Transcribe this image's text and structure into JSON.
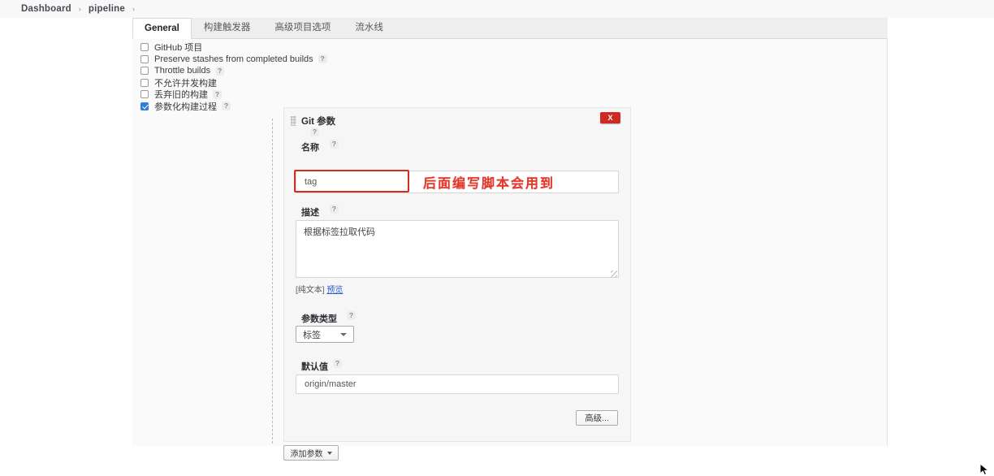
{
  "breadcrumb": {
    "items": [
      "Dashboard",
      "pipeline"
    ],
    "separator": "›"
  },
  "tabs": [
    {
      "label": "General",
      "active": true
    },
    {
      "label": "构建触发器",
      "active": false
    },
    {
      "label": "高级项目选项",
      "active": false
    },
    {
      "label": "流水线",
      "active": false
    }
  ],
  "checkboxes": [
    {
      "label": "GitHub 项目",
      "checked": false,
      "help": false
    },
    {
      "label": "Preserve stashes from completed builds",
      "checked": false,
      "help": true
    },
    {
      "label": "Throttle builds",
      "checked": false,
      "help": true
    },
    {
      "label": "不允许并发构建",
      "checked": false,
      "help": false
    },
    {
      "label": "丢弃旧的构建",
      "checked": false,
      "help": true
    },
    {
      "label": "参数化构建过程",
      "checked": true,
      "help": true
    }
  ],
  "help_glyph": "?",
  "parameter": {
    "title": "Git 参数",
    "delete_label": "X",
    "name_label": "名称",
    "name_value": "tag",
    "description_label": "描述",
    "description_value": "根据标签拉取代码",
    "plain_text_label": "[纯文本]",
    "preview_label": "预览",
    "param_type_label": "参数类型",
    "param_type_value": "标签",
    "default_value_label": "默认值",
    "default_value": "origin/master",
    "advanced_label": "高级..."
  },
  "add_param_button": {
    "label": "添加参数"
  },
  "annotation": {
    "text": "后面编写脚本会用到",
    "color": "#e0392c"
  },
  "colors": {
    "accent_checkbox": "#2f7ed8",
    "delete_red": "#cc2b24",
    "link_blue": "#2a59c8",
    "annotation_red": "#e0392c"
  }
}
